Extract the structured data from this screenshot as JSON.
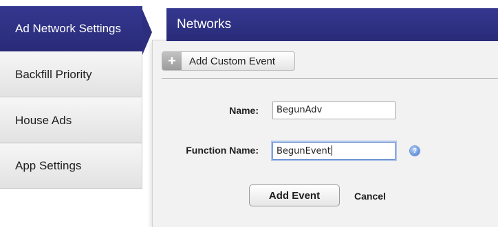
{
  "sidebar": {
    "items": [
      {
        "label": "Ad Network Settings",
        "active": true
      },
      {
        "label": "Backfill Priority",
        "active": false
      },
      {
        "label": "House Ads",
        "active": false
      },
      {
        "label": "App Settings",
        "active": false
      }
    ]
  },
  "panel": {
    "title": "Networks",
    "add_custom_event_label": "Add Custom Event",
    "add_icon": "plus-icon"
  },
  "form": {
    "name_label": "Name:",
    "name_value": "BegunAdv",
    "function_name_label": "Function Name:",
    "function_name_value": "BegunEvent",
    "help_icon": "question-icon",
    "help_glyph": "?",
    "add_event_label": "Add Event",
    "cancel_label": "Cancel"
  },
  "colors": {
    "accent": "#2f3186",
    "panel_bg": "#f2f2f2",
    "sidebar_bg": "#e8e8e8",
    "focus": "#6a8fcf"
  }
}
